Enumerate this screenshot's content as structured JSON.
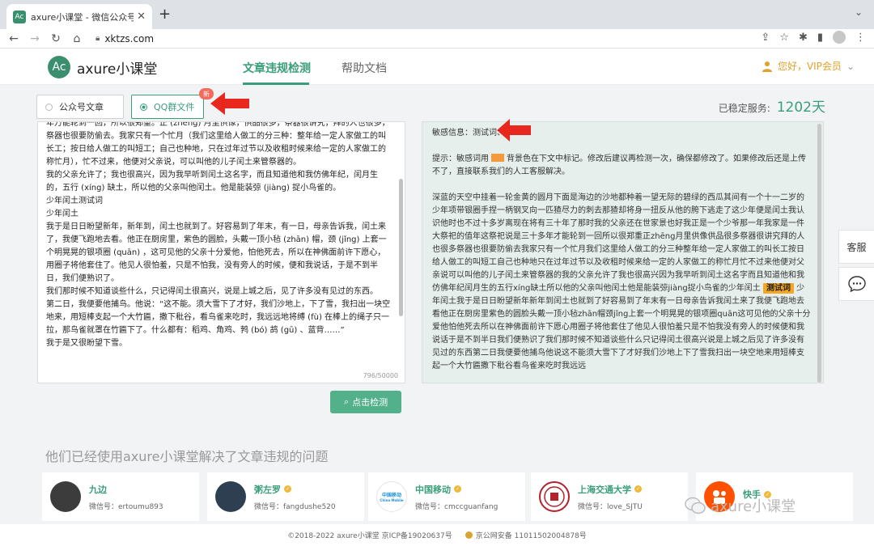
{
  "browser": {
    "tab_favicon": "Ac",
    "tab_title": "axure小课堂 - 微信公众号敏感词",
    "url": "xktzs.com"
  },
  "header": {
    "logo_mark": "Ac",
    "logo_text": "axure小课堂",
    "nav_active": "文章违规检测",
    "nav_help": "帮助文档",
    "user_greeting": "您好，VIP会员"
  },
  "options": {
    "article": "公众号文章",
    "qq": "QQ群文件",
    "new_badge": "新",
    "service_label": "已稳定服务:",
    "service_days": "1202天"
  },
  "editor": {
    "text": "年万能轮到一回，所以很郑重。正 (zhēng) 月里供像，供品很多，祭器很讲究，拜的人也很多，祭器也很要防偷去。我家只有一个忙月（我们这里给人做工的分三种：整年给一定人家做工的叫长工；按日给人做工的叫短工；自己也种地，只在过年过节以及收租时候来给一定的人家做工的称忙月），忙不过来，他便对父亲说，可以叫他的儿子闰土来管祭器的。\n我的父亲允许了；我也很高兴，因为我早听到闰土这名字，而且知道他和我仿佛年纪，闰月生的，五行 (xíng) 缺土，所以他的父亲叫他闰土。他是能装弶 (jiàng) 捉小鸟雀的。\n少年闰土测试词\n少年闰土\n我于是日日盼望新年，新年到，闰土也就到了。好容易到了年末，有一日，母亲告诉我，闰土来了，我便飞跑地去看。他正在厨房里，紫色的圆脸，头戴一顶小毡 (zhān) 帽，颈 (jǐng) 上套一个明晃晃的银项圈 (quān) ，这可见他的父亲十分爱他，怕他死去，所以在神佛面前许下愿心，用圈子将他套住了。他见人很怕羞，只是不怕我，没有旁人的时候，便和我说话，于是不到半日，我们便熟识了。\n我们那时候不知道谈些什么，只记得闰土很高兴，说是上城之后，见了许多没有见过的东西。\n第二日，我便要他捕鸟。他说：“这不能。须大雪下了才好，我们沙地上，下了雪，我扫出一块空地来，用短棒支起一个大竹匾，撒下秕谷，看鸟雀来吃时，我远远地将缚 (fù) 在棒上的绳子只一拉，那鸟雀就罩在竹匾下了。什么都有：稻鸡、角鸡、鹁 (bó) 鸪 (gū) 、蓝背……”\n我于是又很盼望下雪。",
    "counter": "796/50000",
    "check_button": "点击检测"
  },
  "result": {
    "sensitive_info": "敏感信息：测试词、",
    "hint_prefix": "提示：敏感词用",
    "hint_suffix": "背景色在下文中标记。修改后建议再检测一次，确保都修改了。如果修改后还是上传不了，直接联系我们的人工客服解决。",
    "body_before": "深蓝的天空中挂着一轮金黄的圆月下面是海边的沙地都种着一望无际的碧绿的西瓜其间有一个十一二岁的少年项带银圈手捏一柄钢叉向一匹猹尽力的刺去那猹却将身一扭反从他的胯下逃走了这少年便是闰土我认识他时也不过十多岁离现在将有三十年了那时我的父亲还在世家景也好我正是一个少爷那一年我家是一件大祭祀的值年这祭祀说是三十多年才能轮到一回所以很郑重正zhēng月里供像供品很多祭器很讲究拜的人也很多祭器也很要防偷去我家只有一个忙月我们这里给人做工的分三种整年给一定人家做工的叫长工按日给人做工的叫短工自己也种地只在过年过节以及收租时候来给一定的人家做工的称忙月忙不过来他便对父亲说可以叫他的儿子闰土来管祭器的我的父亲允许了我也很高兴因为我早听到闰土这名字而且知道他和我仿佛年纪闰月生的五行xíng缺土所以他的父亲叫他闰土他是能装弶jiàng捉小鸟雀的少年闰土",
    "highlight": "测试词",
    "body_after": "少年闰土我于是日日盼望新年新年到闰土也就到了好容易到了年末有一日母亲告诉我闰土来了我便飞跑地去看他正在厨房里紫色的圆脸头戴一顶小毡zhān帽颈jǐng上套一个明晃晃的银项圈quān这可见他的父亲十分爱他怕他死去所以在神佛面前许下愿心用圈子将他套住了他见人很怕羞只是不怕我没有旁人的时候便和我说话于是不到半日我们便熟识了我们那时候不知道谈些什么只记得闰土很高兴说是上城之后见了许多没有见过的东西第二日我便要他捕鸟他说这不能须大雪下了才好我们沙地上下了雪我扫出一块空地来用短棒支起一个大竹匾撒下秕谷看鸟雀来吃时我远远"
  },
  "side": {
    "service": "客服"
  },
  "users": {
    "title": "他们已经使用axure小课堂解决了文章违规的问题",
    "cards": [
      {
        "name": "九边",
        "id": "微信号：ertoumu893",
        "verified": false
      },
      {
        "name": "粥左罗",
        "id": "微信号：fangdushe520",
        "verified": true
      },
      {
        "name": "中国移动",
        "id": "微信号：cmccguanfang",
        "verified": true,
        "avatar_text": "中国移动",
        "avatar_sub": "China Mobile"
      },
      {
        "name": "上海交通大学",
        "id": "微信号：love_SJTU",
        "verified": true
      },
      {
        "name": "快手",
        "id": "",
        "verified": true
      }
    ]
  },
  "footer": {
    "copyright": "©2018-2022 axure小课堂 京ICP备19020637号",
    "police": "京公网安备 11011502004878号"
  },
  "watermark": "axure小课堂",
  "colors": {
    "brand": "#3a9e7a",
    "highlight": "#f5a623",
    "arrow": "#e8281e",
    "vip": "#e0a22a"
  }
}
